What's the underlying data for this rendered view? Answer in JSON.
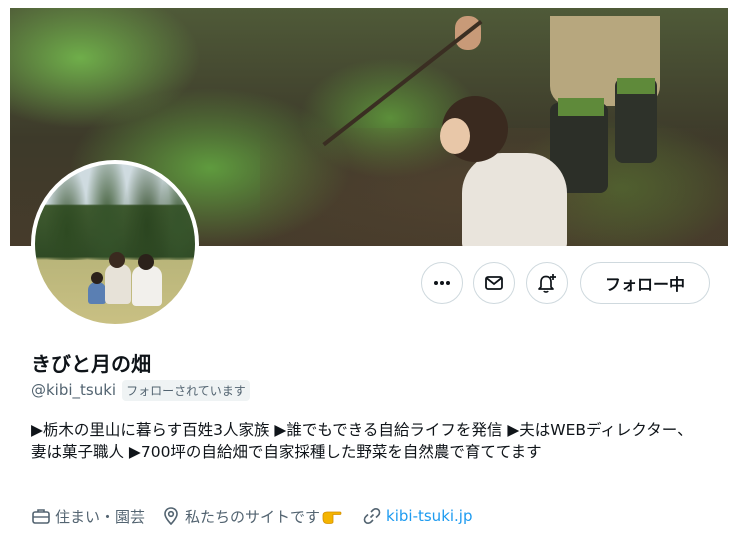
{
  "profile": {
    "display_name": "きびと月の畑",
    "handle": "@kibi_tsuki",
    "follows_you_badge": "フォローされています",
    "bio": "▶栃木の里山に暮らす百姓3人家族 ▶誰でもできる自給ライフを発信 ▶夫はWEBディレクター、妻は菓子職人 ▶700坪の自給畑で自家採種した野菜を自然農で育ててます",
    "meta": {
      "category": "住まい・園芸",
      "location": "私たちのサイトです",
      "link": "kibi-tsuki.jp"
    }
  },
  "actions": {
    "more_icon": "more-horizontal-icon",
    "message_icon": "envelope-icon",
    "notifications_icon": "bell-plus-icon",
    "follow_label": "フォロー中"
  },
  "colors": {
    "link": "#1d9bf0",
    "secondary_text": "#536471",
    "border": "#cfd9de"
  }
}
